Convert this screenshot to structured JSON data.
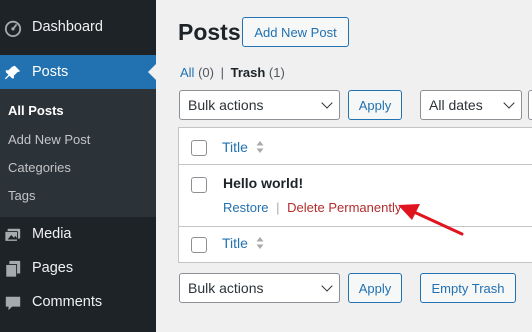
{
  "sidebar": {
    "items": [
      {
        "label": "Dashboard",
        "icon": "dashboard-icon"
      },
      {
        "label": "Posts",
        "icon": "pushpin-icon",
        "active": true
      },
      {
        "label": "Media",
        "icon": "media-icon"
      },
      {
        "label": "Pages",
        "icon": "pages-icon"
      },
      {
        "label": "Comments",
        "icon": "comments-icon"
      }
    ],
    "submenu": [
      "All Posts",
      "Add New Post",
      "Categories",
      "Tags"
    ]
  },
  "header": {
    "title": "Posts",
    "add_new_label": "Add New Post"
  },
  "filters": {
    "all_label": "All",
    "all_count": "(0)",
    "separator": "|",
    "trash_label": "Trash",
    "trash_count": "(1)"
  },
  "toolbar": {
    "bulk_actions": "Bulk actions",
    "apply_label": "Apply",
    "dates": "All dates",
    "empty_trash_label": "Empty Trash"
  },
  "table": {
    "column_title": "Title",
    "rows": [
      {
        "title": "Hello world!",
        "restore": "Restore",
        "separator": "|",
        "delete": "Delete Permanently"
      }
    ]
  },
  "colors": {
    "sidebar_bg": "#1d2327",
    "accent": "#2271b1",
    "delete": "#b32d2e",
    "annotation_arrow": "#e0141e"
  }
}
